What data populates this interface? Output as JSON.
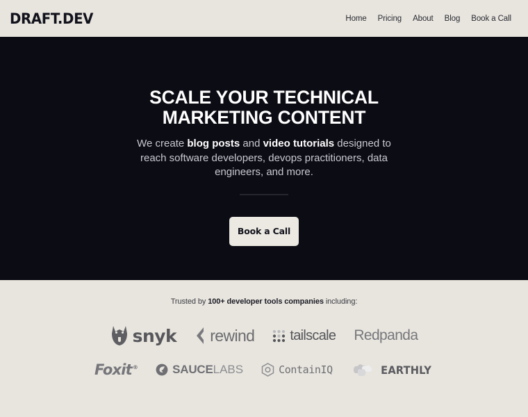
{
  "theme": {
    "cream": "#e8e5de",
    "dark": "#0c0c14",
    "text_dark": "#12121c",
    "text_muted": "#c9c9d2",
    "button_bg": "#ece9e2"
  },
  "header": {
    "brand": "DRAFT.DEV",
    "nav": [
      {
        "label": "Home"
      },
      {
        "label": "Pricing"
      },
      {
        "label": "About"
      },
      {
        "label": "Blog"
      },
      {
        "label": "Book a Call"
      }
    ]
  },
  "hero": {
    "title": "SCALE YOUR TECHNICAL MARKETING CONTENT",
    "subtitle": {
      "part1": "We create ",
      "bold1": "blog posts",
      "part2": " and ",
      "bold2": "video tutorials",
      "part3": " designed to reach software developers, devops practitioners, data engineers, and more."
    },
    "cta_label": "Book a Call"
  },
  "trusted": {
    "label_pre": "Trusted by ",
    "label_bold": "100+ developer tools companies",
    "label_post": " including:",
    "rows": [
      [
        {
          "name": "snyk",
          "wordmark": "snyk",
          "icon": "doberman-head-icon"
        },
        {
          "name": "rewind",
          "wordmark": "rewind",
          "icon": "chevron-left-icon"
        },
        {
          "name": "tailscale",
          "wordmark": "tailscale",
          "icon": "dot-grid-icon"
        },
        {
          "name": "redpanda",
          "wordmark": "Redpanda",
          "icon": "none"
        }
      ],
      [
        {
          "name": "foxit",
          "wordmark": "Foxit",
          "trademark": "®",
          "icon": "none"
        },
        {
          "name": "saucelabs",
          "wordmark_bold": "SAUCE",
          "wordmark_light": "LABS",
          "icon": "swirl-icon"
        },
        {
          "name": "containiq",
          "wordmark": "ContainIQ",
          "icon": "hexagon-icon"
        },
        {
          "name": "earthly",
          "wordmark": "EARTHLY",
          "icon": "overlapping-shapes-icon"
        }
      ]
    ]
  }
}
